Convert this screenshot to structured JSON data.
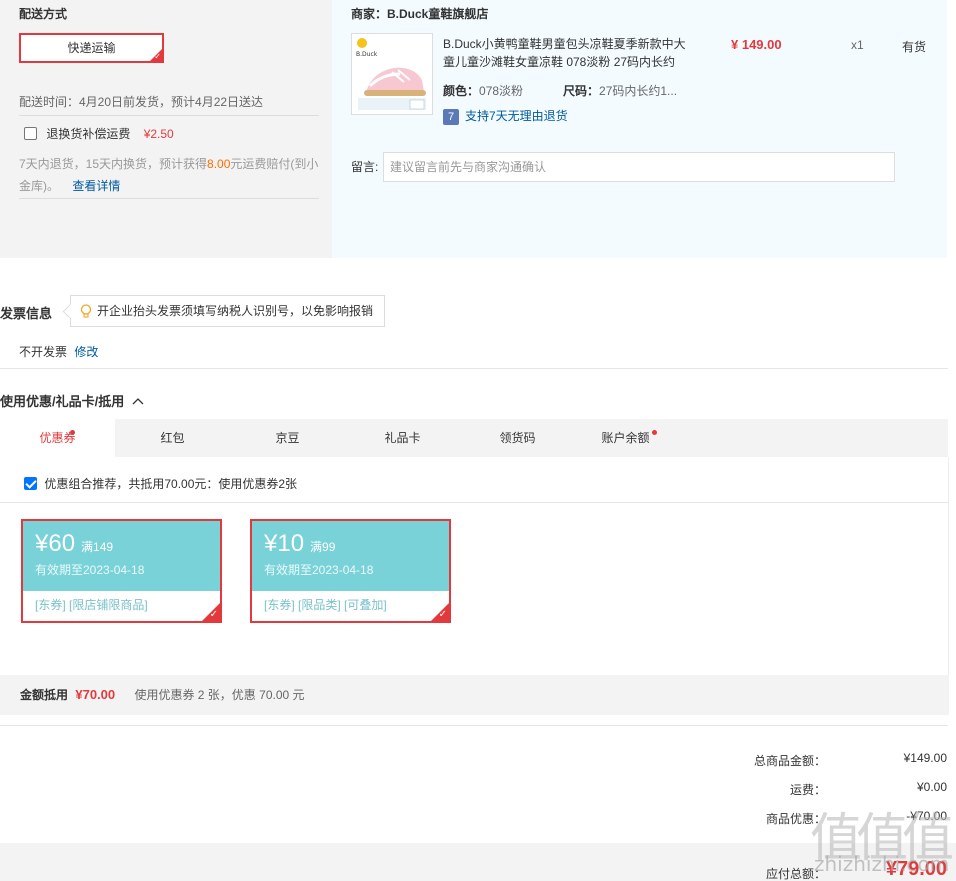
{
  "delivery": {
    "title": "配送方式",
    "method_label": "快递运输",
    "time_text": "配送时间：4月20日前发货，预计4月22日送达",
    "insurance_label": "退换货补偿运费",
    "insurance_price": "¥2.50",
    "insurance_note_a": "7天内退货，15天内换货，预计获得",
    "insurance_note_amount": "8.00",
    "insurance_note_b": "元运费赔付(到小",
    "insurance_note_c": "金库)。",
    "detail_link": "查看详情"
  },
  "shop": {
    "label": "商家：B.Duck童鞋旗舰店",
    "product": {
      "title_line1": "B.Duck小黄鸭童鞋男童包头凉鞋夏季新款中大",
      "title_line2": "童儿童沙滩鞋女童凉鞋 078淡粉 27码内长约",
      "price": "¥ 149.00",
      "qty": "x1",
      "stock": "有货",
      "color_label": "颜色：",
      "color_value": "078淡粉",
      "size_label": "尺码：",
      "size_value": "27码内长约1...",
      "return_badge": "7",
      "return_text": "支持7天无理由退货",
      "img_logo": "B.Duck"
    },
    "message_label": "留言:",
    "message_placeholder": "建议留言前先与商家沟通确认"
  },
  "invoice": {
    "title": "发票信息",
    "tip": "开企业抬头发票须填写纳税人识别号，以免影响报销",
    "status": "不开发票",
    "edit": "修改"
  },
  "discount": {
    "title": "使用优惠/礼品卡/抵用",
    "tabs": [
      {
        "label": "优惠券"
      },
      {
        "label": "红包"
      },
      {
        "label": "京豆"
      },
      {
        "label": "礼品卡"
      },
      {
        "label": "领货码"
      },
      {
        "label": "账户余额"
      }
    ],
    "combo_text": "优惠组合推荐，共抵用70.00元：使用优惠券2张",
    "coupons": [
      {
        "amount": "¥60",
        "condition": "满149",
        "expiry": "有效期至2023-04-18",
        "tags": "[东券]  [限店铺限商品]"
      },
      {
        "amount": "¥10",
        "condition": "满99",
        "expiry": "有效期至2023-04-18",
        "tags": "[东券]  [限品类]  [可叠加]"
      }
    ],
    "summary_label": "金额抵用",
    "summary_amount": "¥70.00",
    "summary_note": "使用优惠券 2 张，优惠 70.00 元"
  },
  "totals": {
    "goods_label": "总商品金额：",
    "goods_value": "¥149.00",
    "freight_label": "运费：",
    "freight_value": "¥0.00",
    "discount_label": "商品优惠：",
    "discount_value": "-¥70.00",
    "payable_label": "应付总额：",
    "payable_value": "¥79.00"
  },
  "watermark": {
    "main": "值值值",
    "url": "zhizhizhi.com"
  },
  "colors": {
    "accent": "#e4393c",
    "coupon": "#79d2d8",
    "link": "#005aa0",
    "orange": "#ff6c00"
  }
}
